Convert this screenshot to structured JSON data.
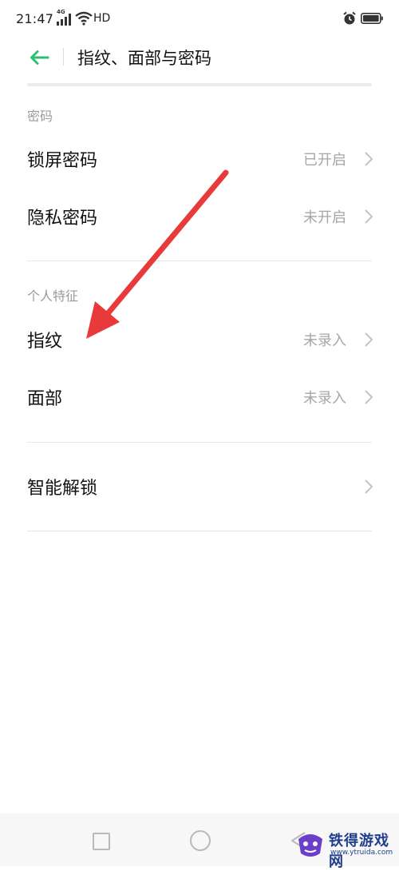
{
  "status_bar": {
    "time": "21:47",
    "network_badge": "4G",
    "network_type": "HD",
    "icons": [
      "signal-icon",
      "wifi-icon",
      "alarm-icon",
      "battery-icon"
    ]
  },
  "header": {
    "title": "指纹、面部与密码",
    "back_icon": "arrow-left-icon"
  },
  "sections": {
    "password": {
      "label": "密码",
      "items": [
        {
          "title": "锁屏密码",
          "status": "已开启"
        },
        {
          "title": "隐私密码",
          "status": "未开启"
        }
      ]
    },
    "biometrics": {
      "label": "个人特征",
      "items": [
        {
          "title": "指纹",
          "status": "未录入"
        },
        {
          "title": "面部",
          "status": "未录入"
        }
      ]
    },
    "smart_unlock": {
      "title": "智能解锁"
    }
  },
  "colors": {
    "accent": "#2fbf71",
    "annotation": "#e83a3a",
    "secondary_text": "#a6a6a6"
  },
  "navigation": {
    "icons": [
      "recent-apps-icon",
      "home-icon",
      "back-icon"
    ]
  },
  "watermark": {
    "text": "铁得游戏网",
    "url": "www.ytruida.com"
  }
}
